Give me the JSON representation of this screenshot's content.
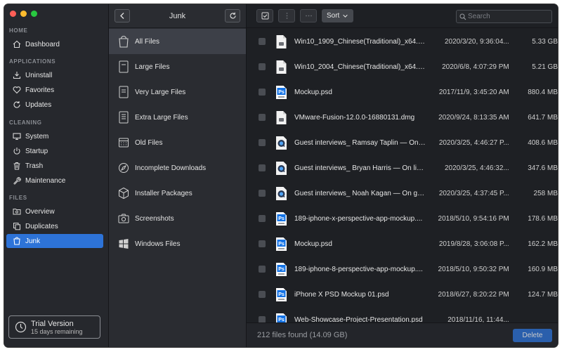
{
  "sidebar": {
    "sections": {
      "home": "HOME",
      "applications": "APPLICATIONS",
      "cleaning": "CLEANING",
      "files": "FILES"
    },
    "items": {
      "dashboard": "Dashboard",
      "uninstall": "Uninstall",
      "favorites": "Favorites",
      "updates": "Updates",
      "system": "System",
      "startup": "Startup",
      "trash": "Trash",
      "maintenance": "Maintenance",
      "overview": "Overview",
      "duplicates": "Duplicates",
      "junk": "Junk"
    },
    "trial": {
      "title": "Trial Version",
      "subtitle": "15 days remaining"
    }
  },
  "middle": {
    "title": "Junk",
    "items": [
      "All Files",
      "Large Files",
      "Very Large Files",
      "Extra Large Files",
      "Old Files",
      "Incomplete Downloads",
      "Installer Packages",
      "Screenshots",
      "Windows Files"
    ]
  },
  "toolbar": {
    "sort_label": "Sort",
    "search_placeholder": "Search"
  },
  "files": [
    {
      "name": "Win10_1909_Chinese(Traditional)_x64.iso",
      "date": "2020/3/20, 9:36:04...",
      "size": "5.33 GB",
      "icon": "document-icon"
    },
    {
      "name": "Win10_2004_Chinese(Traditional)_x64.iso",
      "date": "2020/6/8, 4:07:29 PM",
      "size": "5.21 GB",
      "icon": "document-icon"
    },
    {
      "name": "Mockup.psd",
      "date": "2017/11/9, 3:45:20 AM",
      "size": "880.4 MB",
      "icon": "psd-icon"
    },
    {
      "name": "VMware-Fusion-12.0.0-16880131.dmg",
      "date": "2020/9/24, 8:13:35 AM",
      "size": "641.7 MB",
      "icon": "document-icon"
    },
    {
      "name": "Guest interviews_ Ramsay Taplin — On st...",
      "date": "2020/3/25, 4:46:27 P...",
      "size": "408.6 MB",
      "icon": "quicktime-icon"
    },
    {
      "name": "Guest interviews_ Bryan Harris — On list...",
      "date": "2020/3/25, 4:46:32...",
      "size": "347.6 MB",
      "icon": "quicktime-icon"
    },
    {
      "name": "Guest interviews_ Noah Kagan — On gro...",
      "date": "2020/3/25, 4:37:45 P...",
      "size": "258 MB",
      "icon": "quicktime-icon"
    },
    {
      "name": "189-iphone-x-perspective-app-mockup....",
      "date": "2018/5/10, 9:54:16 PM",
      "size": "178.6 MB",
      "icon": "psd-icon"
    },
    {
      "name": "Mockup.psd",
      "date": "2019/8/28, 3:06:08 P...",
      "size": "162.2 MB",
      "icon": "psd-icon"
    },
    {
      "name": "189-iphone-8-perspective-app-mockup....",
      "date": "2018/5/10, 9:50:32 PM",
      "size": "160.9 MB",
      "icon": "psd-icon"
    },
    {
      "name": "iPhone X PSD Mockup 01.psd",
      "date": "2018/6/27, 8:20:22 PM",
      "size": "124.7 MB",
      "icon": "psd-icon"
    },
    {
      "name": "Web-Showcase-Project-Presentation.psd",
      "date": "2018/11/16, 11:44...",
      "size": "",
      "icon": "psd-icon"
    }
  ],
  "footer": {
    "count_text": "212 files found (14.09 GB)",
    "delete_label": "Delete"
  },
  "colors": {
    "accent": "#2d73d8",
    "psd_blue": "#1473e6"
  }
}
